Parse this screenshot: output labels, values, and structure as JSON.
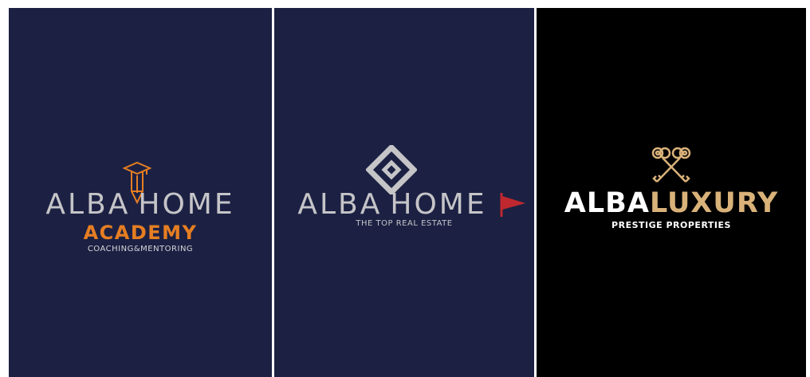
{
  "academy": {
    "word_left": "ALBA",
    "word_right": "HOME",
    "subtitle": "ACADEMY",
    "tagline": "COACHING&MENTORING",
    "icon": "graduation-pencil-icon"
  },
  "home": {
    "word_left": "ALBA",
    "word_right": "HOME",
    "tagline": "THE TOP REAL ESTATE",
    "icon": "diamond-house-icon",
    "flag_icon": "red-flag-icon"
  },
  "luxury": {
    "word_left": "ALBA",
    "word_right": "LUXURY",
    "tagline": "PRESTIGE PROPERTIES",
    "icon": "crossed-keys-icon"
  },
  "colors": {
    "navy": "#1c2143",
    "black": "#000000",
    "grey_text": "#c5c5c8",
    "orange": "#e67e22",
    "gold": "#d9b27a",
    "red_flag": "#c0282f"
  }
}
